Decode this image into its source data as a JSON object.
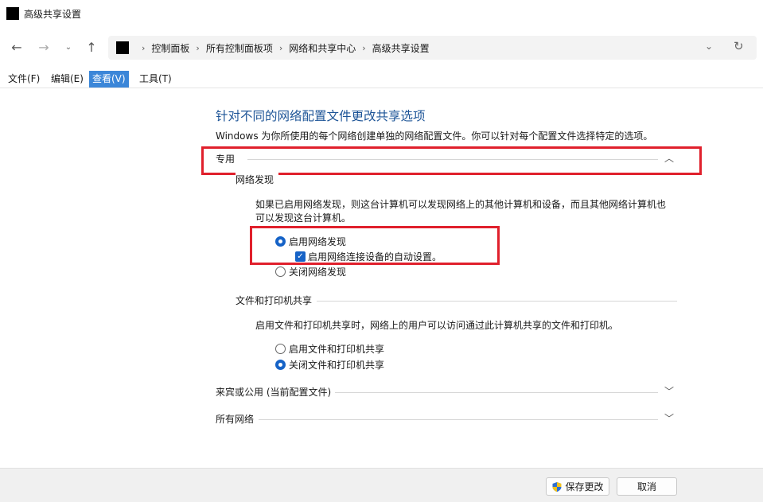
{
  "window": {
    "title": "高级共享设置"
  },
  "nav": {
    "back_icon": "←",
    "forward_icon": "→",
    "recent_icon": "⌄",
    "up_icon": "↑",
    "breadcrumbs": [
      "控制面板",
      "所有控制面板项",
      "网络和共享中心",
      "高级共享设置"
    ],
    "separator": "›",
    "dropdown_icon": "⌄",
    "refresh_icon": "↻"
  },
  "menu": {
    "items": [
      {
        "label": "文件(F)"
      },
      {
        "label": "编辑(E)"
      },
      {
        "label": "查看(V)"
      },
      {
        "label": "工具(T)"
      }
    ]
  },
  "main": {
    "title": "针对不同的网络配置文件更改共享选项",
    "description": "Windows 为你所使用的每个网络创建单独的网络配置文件。你可以针对每个配置文件选择特定的选项。",
    "sections": {
      "private": {
        "label": "专用",
        "chevron": "︿",
        "network_discovery": {
          "label": "网络发现",
          "desc_line1": "如果已启用网络发现，则这台计算机可以发现网络上的其他计算机和设备，而且其他网络计算机也",
          "desc_line2": "可以发现这台计算机。",
          "option_on": "启用网络发现",
          "auto_setup": "启用网络连接设备的自动设置。",
          "option_off": "关闭网络发现"
        },
        "file_printer": {
          "label": "文件和打印机共享",
          "desc": "启用文件和打印机共享时，网络上的用户可以访问通过此计算机共享的文件和打印机。",
          "option_on": "启用文件和打印机共享",
          "option_off": "关闭文件和打印机共享"
        }
      },
      "guest": {
        "label": "来宾或公用 (当前配置文件)",
        "chevron": "﹀"
      },
      "all": {
        "label": "所有网络",
        "chevron": "﹀"
      }
    }
  },
  "footer": {
    "save_label": "保存更改",
    "cancel_label": "取消"
  },
  "colors": {
    "accent": "#1663c7",
    "title_blue": "#1d5497",
    "highlight_red": "#e0202c",
    "menu_active": "#3b86d8"
  }
}
